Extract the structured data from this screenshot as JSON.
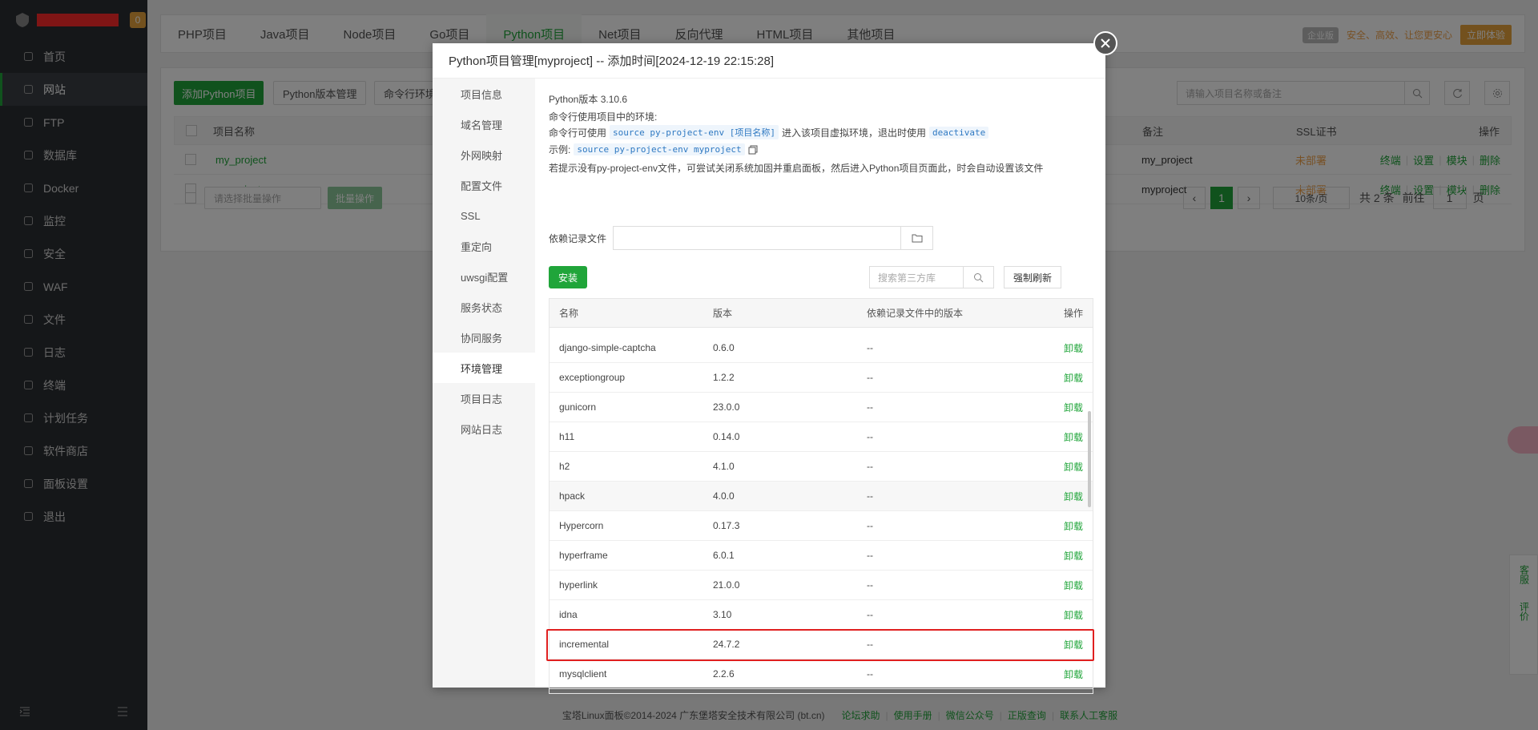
{
  "sidebar": {
    "badge": "0",
    "items": [
      {
        "label": "首页",
        "icon": "home-icon"
      },
      {
        "label": "网站",
        "icon": "globe-icon",
        "active": true
      },
      {
        "label": "FTP",
        "icon": "ftp-icon"
      },
      {
        "label": "数据库",
        "icon": "database-icon"
      },
      {
        "label": "Docker",
        "icon": "docker-icon"
      },
      {
        "label": "监控",
        "icon": "monitor-icon"
      },
      {
        "label": "安全",
        "icon": "shield-icon"
      },
      {
        "label": "WAF",
        "icon": "waf-icon"
      },
      {
        "label": "文件",
        "icon": "folder-icon"
      },
      {
        "label": "日志",
        "icon": "log-icon"
      },
      {
        "label": "终端",
        "icon": "terminal-icon"
      },
      {
        "label": "计划任务",
        "icon": "calendar-icon"
      },
      {
        "label": "软件商店",
        "icon": "grid-icon"
      },
      {
        "label": "面板设置",
        "icon": "gear-icon"
      },
      {
        "label": "退出",
        "icon": "logout-icon"
      }
    ]
  },
  "tabs": [
    "PHP项目",
    "Java项目",
    "Node项目",
    "Go项目",
    "Python项目",
    "Net项目",
    "反向代理",
    "HTML项目",
    "其他项目"
  ],
  "promo": {
    "tag": "企业版",
    "text": "安全、高效、让您更安心",
    "button": "立即体验"
  },
  "toolbar": {
    "add": "添加Python项目",
    "version_mgmt": "Python版本管理",
    "cmd_env": "命令行环境管",
    "search_placeholder": "请输入项目名称或备注"
  },
  "projects": {
    "headers": {
      "name": "项目名称",
      "remark": "备注",
      "ssl": "SSL证书",
      "ops": "操作"
    },
    "rows": [
      {
        "name": "my_project",
        "remark": "my_project",
        "ssl": "未部署",
        "ops": [
          "终端",
          "设置",
          "模块",
          "删除"
        ]
      },
      {
        "name": "myproject",
        "remark": "myproject",
        "ssl": "未部署",
        "ops": [
          "终端",
          "设置",
          "模块",
          "删除"
        ]
      }
    ],
    "batch_placeholder": "请选择批量操作",
    "batch_button": "批量操作"
  },
  "pager": {
    "page": "1",
    "per_page": "10条/页",
    "total": "共 2 条",
    "goto": "前往",
    "goto_value": "1",
    "unit": "页"
  },
  "footer": {
    "copyright": "宝塔Linux面板©2014-2024 广东堡塔安全技术有限公司 (bt.cn)",
    "links": [
      "论坛求助",
      "使用手册",
      "微信公众号",
      "正版查询",
      "联系人工客服"
    ]
  },
  "float": {
    "service": "客服",
    "review": "评价"
  },
  "modal": {
    "title": "Python项目管理[myproject] -- 添加时间[2024-12-19 22:15:28]",
    "nav": [
      "项目信息",
      "域名管理",
      "外网映射",
      "配置文件",
      "SSL",
      "重定向",
      "uwsgi配置",
      "服务状态",
      "协同服务",
      "环境管理",
      "项目日志",
      "网站日志"
    ],
    "active_nav": 9,
    "python_version": "Python版本 3.10.6",
    "cmd_hint": "命令行使用项目中的环境:",
    "cmd_use_prefix": "命令行可使用",
    "cmd_source": "source py-project-env [项目名称]",
    "cmd_use_mid": "进入该项目虚拟环境，退出时使用",
    "cmd_deactivate": "deactivate",
    "example_label": "示例:",
    "example_code": "source py-project-env myproject",
    "missing_hint": "若提示没有py-project-env文件，可尝试关闭系统加固并重启面板，然后进入Python项目页面此，时会自动设置该文件",
    "dep_file_label": "依赖记录文件",
    "install": "安装",
    "search_placeholder": "搜索第三方库",
    "force_refresh": "强制刷新",
    "table_headers": {
      "name": "名称",
      "version": "版本",
      "dep_version": "依赖记录文件中的版本",
      "ops": "操作"
    },
    "packages": [
      {
        "name": "django-simple-captcha",
        "version": "0.6.0",
        "dep": "--",
        "op": "卸载"
      },
      {
        "name": "exceptiongroup",
        "version": "1.2.2",
        "dep": "--",
        "op": "卸载"
      },
      {
        "name": "gunicorn",
        "version": "23.0.0",
        "dep": "--",
        "op": "卸载"
      },
      {
        "name": "h11",
        "version": "0.14.0",
        "dep": "--",
        "op": "卸载"
      },
      {
        "name": "h2",
        "version": "4.1.0",
        "dep": "--",
        "op": "卸载"
      },
      {
        "name": "hpack",
        "version": "4.0.0",
        "dep": "--",
        "op": "卸载"
      },
      {
        "name": "Hypercorn",
        "version": "0.17.3",
        "dep": "--",
        "op": "卸载"
      },
      {
        "name": "hyperframe",
        "version": "6.0.1",
        "dep": "--",
        "op": "卸载"
      },
      {
        "name": "hyperlink",
        "version": "21.0.0",
        "dep": "--",
        "op": "卸载"
      },
      {
        "name": "idna",
        "version": "3.10",
        "dep": "--",
        "op": "卸载"
      },
      {
        "name": "incremental",
        "version": "24.7.2",
        "dep": "--",
        "op": "卸载"
      },
      {
        "name": "mysqlclient",
        "version": "2.2.6",
        "dep": "--",
        "op": "卸载"
      }
    ]
  }
}
